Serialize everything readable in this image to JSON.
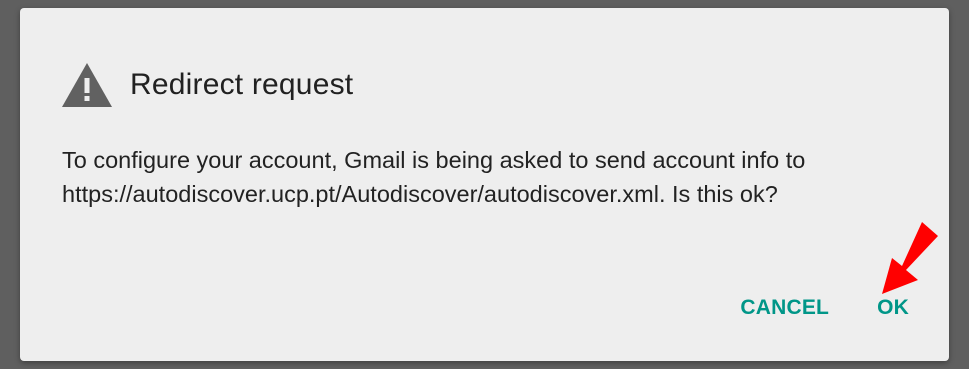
{
  "dialog": {
    "title": "Redirect request",
    "title_icon": "warning-icon",
    "message": "To configure your account, Gmail is being asked to send account info to https://autodiscover.ucp.pt/Autodiscover/autodiscover.xml. Is this ok?",
    "buttons": {
      "cancel_label": "CANCEL",
      "ok_label": "OK"
    }
  },
  "annotation": {
    "icon": "red-arrow-icon",
    "points_to": "OK"
  },
  "colors": {
    "backdrop": "#5f5f5f",
    "dialog_background": "#eeeeee",
    "title_text": "#212121",
    "body_text": "#222222",
    "accent": "#009688",
    "warning_icon": "#616161",
    "annotation_arrow": "#ff0000"
  }
}
